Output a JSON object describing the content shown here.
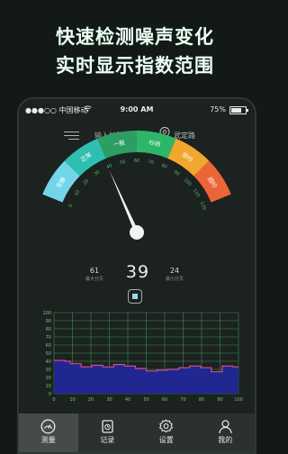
{
  "hero": {
    "line1": "快速检测噪声变化",
    "line2": "实时显示指数范围"
  },
  "status": {
    "carrier": "●●●○○ 中国移动",
    "time": "9:00 AM",
    "battery": "75%"
  },
  "toolbar": {
    "title_placeholder": "输入标题",
    "location": "武定路"
  },
  "gauge": {
    "reading_db": 39,
    "segments": [
      {
        "label": "安静",
        "color": "#73d6e8"
      },
      {
        "label": "正常",
        "color": "#2fbfb0"
      },
      {
        "label": "一般",
        "color": "#2d9e63"
      },
      {
        "label": "吵闹",
        "color": "#2db568"
      },
      {
        "label": "很吵",
        "color": "#f0a730"
      },
      {
        "label": "超吵",
        "color": "#ec6537"
      }
    ],
    "ticks": [
      "0",
      "10",
      "20",
      "30",
      "40",
      "50",
      "60",
      "70",
      "80",
      "90",
      "100",
      "110",
      "120"
    ]
  },
  "readouts": {
    "max_value": "61",
    "max_label": "最大分贝",
    "current_value": "39",
    "min_value": "24",
    "min_label": "最小分贝"
  },
  "chart_data": {
    "type": "area",
    "x_ticks": [
      "0",
      "10",
      "20",
      "30",
      "40",
      "50",
      "60",
      "70",
      "80",
      "90",
      "100"
    ],
    "y_ticks": [
      "100",
      "90",
      "80",
      "70",
      "60",
      "50",
      "40",
      "30",
      "20",
      "10",
      "0"
    ],
    "ylim": [
      0,
      100
    ],
    "grid": true,
    "values": [
      41,
      41,
      40,
      37,
      37,
      33,
      33,
      35,
      35,
      33,
      33,
      36,
      36,
      34,
      34,
      31,
      31,
      28,
      28,
      29,
      29,
      30,
      30,
      32,
      32,
      34,
      34,
      32,
      32,
      27,
      27,
      34,
      34,
      33
    ],
    "colors": {
      "fill": "#202790",
      "line": "#d54b8c",
      "grid": "#3b8f56",
      "axis_text": "#7ac27f"
    }
  },
  "tabs": [
    {
      "label": "测量",
      "icon": "gauge-icon"
    },
    {
      "label": "记录",
      "icon": "record-icon"
    },
    {
      "label": "设置",
      "icon": "gear-icon"
    },
    {
      "label": "我的",
      "icon": "profile-icon"
    }
  ]
}
